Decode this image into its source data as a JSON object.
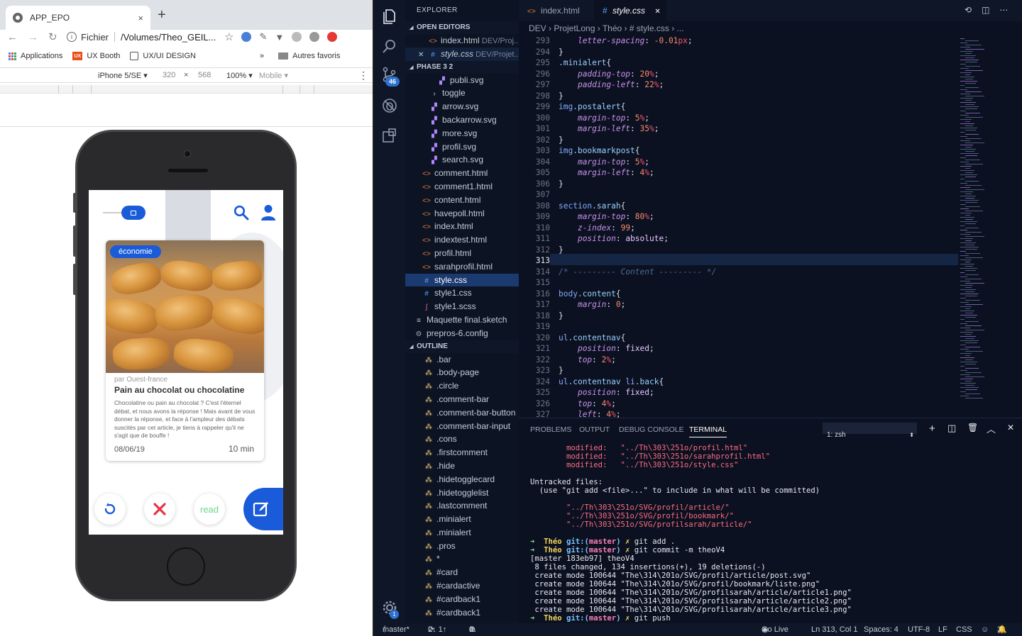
{
  "browser": {
    "tab_title": "APP_EPO",
    "close": "×",
    "new_tab": "+",
    "address_label": "Fichier",
    "address_path": "/Volumes/Theo_GEIL...",
    "bookmarks": [
      {
        "label": "Applications"
      },
      {
        "label": "UX Booth"
      },
      {
        "label": "UX/UI DESIGN"
      }
    ],
    "bookmarks_more": "»",
    "other_favorites": "Autres favoris",
    "device_toolbar": {
      "device": "iPhone 5/SE ▾",
      "width": "320",
      "times": "×",
      "height": "568",
      "zoom": "100% ▾",
      "network": "Mobile ▾",
      "more": "⋮"
    }
  },
  "app": {
    "card": {
      "badge": "économie",
      "source": "par Ouest-france",
      "title": "Pain au chocolat ou chocolatine",
      "body": "Chocolatine ou pain au chocolat ? C'est l'éternel débat, et nous avons la réponse ! Mais avant de vous donner la réponse, et face à l'ampleur des débats suscités par cet article, je tiens à rappeler qu'il ne s'agit que de bouffe !",
      "date": "08/06/19",
      "duration": "10 min"
    },
    "actions": {
      "read": "read"
    }
  },
  "vscode": {
    "explorer_title": "EXPLORER",
    "open_editors_title": "OPEN EDITORS",
    "open_editors": [
      {
        "close": "",
        "icon": "html",
        "name": "index.html",
        "path": "DEV/Proj..."
      },
      {
        "close": "✕",
        "icon": "css",
        "name": "style.css",
        "path": "DEV/Projet..."
      }
    ],
    "folder_title": "PHASE 3 2",
    "files": [
      {
        "icon": "svg",
        "name": "publi.svg",
        "indent": 3
      },
      {
        "icon": "folder",
        "name": "toggle",
        "indent": 2
      },
      {
        "icon": "svg",
        "name": "arrow.svg",
        "indent": 2
      },
      {
        "icon": "svg",
        "name": "backarrow.svg",
        "indent": 2
      },
      {
        "icon": "svg",
        "name": "more.svg",
        "indent": 2
      },
      {
        "icon": "svg",
        "name": "profil.svg",
        "indent": 2
      },
      {
        "icon": "svg",
        "name": "search.svg",
        "indent": 2
      },
      {
        "icon": "html",
        "name": "comment.html",
        "indent": 1
      },
      {
        "icon": "html",
        "name": "comment1.html",
        "indent": 1
      },
      {
        "icon": "html",
        "name": "content.html",
        "indent": 1
      },
      {
        "icon": "html",
        "name": "havepoll.html",
        "indent": 1
      },
      {
        "icon": "html",
        "name": "index.html",
        "indent": 1
      },
      {
        "icon": "html",
        "name": "indextest.html",
        "indent": 1
      },
      {
        "icon": "html",
        "name": "profil.html",
        "indent": 1
      },
      {
        "icon": "html",
        "name": "sarahprofil.html",
        "indent": 1
      },
      {
        "icon": "css",
        "name": "style.css",
        "indent": 1,
        "selected": true
      },
      {
        "icon": "css",
        "name": "style1.css",
        "indent": 1
      },
      {
        "icon": "scss",
        "name": "style1.scss",
        "indent": 1
      },
      {
        "icon": "sketch",
        "name": "Maquette final.sketch",
        "indent": 0
      },
      {
        "icon": "config",
        "name": "prepros-6.config",
        "indent": 0
      }
    ],
    "outline_title": "OUTLINE",
    "outline": [
      ".bar",
      ".body-page",
      ".circle",
      ".comment-bar",
      ".comment-bar-button",
      ".comment-bar-input",
      ".cons",
      ".firstcomment",
      ".hide",
      ".hidetogglecard",
      ".hidetogglelist",
      ".lastcomment",
      ".minialert",
      ".minialert",
      ".pros",
      "*",
      "#card",
      "#cardactive",
      "#cardback1",
      "#cardback1"
    ],
    "scm_badge": "46",
    "settings_badge": "1",
    "editor_tabs": [
      {
        "label": "index.html"
      },
      {
        "label": "style.css",
        "close": "✕"
      }
    ],
    "breadcrumbs": "DEV › ProjetLong › Théo › # style.css › ...",
    "line_numbers": [
      "293",
      "294",
      "295",
      "296",
      "297",
      "298",
      "299",
      "300",
      "301",
      "302",
      "303",
      "304",
      "305",
      "306",
      "307",
      "308",
      "309",
      "310",
      "311",
      "312",
      "313",
      "314",
      "315",
      "316",
      "317",
      "318",
      "319",
      "320",
      "321",
      "322",
      "323",
      "324",
      "325",
      "326",
      "327"
    ],
    "code_lines": [
      [
        [
          "    ",
          ""
        ],
        [
          "letter-spacing",
          "p"
        ],
        [
          ": ",
          ""
        ],
        [
          "-0.01",
          "n"
        ],
        [
          "px",
          "u"
        ],
        [
          ";",
          ""
        ]
      ],
      [
        [
          "}",
          ""
        ]
      ],
      [
        [
          ".minialert",
          "s"
        ],
        [
          "{",
          ""
        ]
      ],
      [
        [
          "    ",
          ""
        ],
        [
          "padding-top",
          "p"
        ],
        [
          ": ",
          ""
        ],
        [
          "20",
          "n"
        ],
        [
          "%",
          "u"
        ],
        [
          ";",
          ""
        ]
      ],
      [
        [
          "    ",
          ""
        ],
        [
          "padding-left",
          "p"
        ],
        [
          ": ",
          ""
        ],
        [
          "22",
          "n"
        ],
        [
          "%",
          "u"
        ],
        [
          ";",
          ""
        ]
      ],
      [
        [
          "}",
          ""
        ]
      ],
      [
        [
          "img",
          "t"
        ],
        [
          ".postalert",
          "s"
        ],
        [
          "{",
          ""
        ]
      ],
      [
        [
          "    ",
          ""
        ],
        [
          "margin-top",
          "p"
        ],
        [
          ": ",
          ""
        ],
        [
          "5",
          "n"
        ],
        [
          "%",
          "u"
        ],
        [
          ";",
          ""
        ]
      ],
      [
        [
          "    ",
          ""
        ],
        [
          "margin-left",
          "p"
        ],
        [
          ": ",
          ""
        ],
        [
          "35",
          "n"
        ],
        [
          "%",
          "u"
        ],
        [
          ";",
          ""
        ]
      ],
      [
        [
          "}",
          ""
        ]
      ],
      [
        [
          "img",
          "t"
        ],
        [
          ".bookmarkpost",
          "s"
        ],
        [
          "{",
          ""
        ]
      ],
      [
        [
          "    ",
          ""
        ],
        [
          "margin-top",
          "p"
        ],
        [
          ": ",
          ""
        ],
        [
          "5",
          "n"
        ],
        [
          "%",
          "u"
        ],
        [
          ";",
          ""
        ]
      ],
      [
        [
          "    ",
          ""
        ],
        [
          "margin-left",
          "p"
        ],
        [
          ": ",
          ""
        ],
        [
          "4",
          "n"
        ],
        [
          "%",
          "u"
        ],
        [
          ";",
          ""
        ]
      ],
      [
        [
          "}",
          ""
        ]
      ],
      [
        [
          "",
          ""
        ]
      ],
      [
        [
          "section",
          "t"
        ],
        [
          ".sarah",
          "s"
        ],
        [
          "{",
          ""
        ]
      ],
      [
        [
          "    ",
          ""
        ],
        [
          "margin-top",
          "p"
        ],
        [
          ": ",
          ""
        ],
        [
          "80",
          "n"
        ],
        [
          "%",
          "u"
        ],
        [
          ";",
          ""
        ]
      ],
      [
        [
          "    ",
          ""
        ],
        [
          "z-index",
          "p"
        ],
        [
          ": ",
          ""
        ],
        [
          "99",
          "n"
        ],
        [
          ";",
          ""
        ]
      ],
      [
        [
          "    ",
          ""
        ],
        [
          "position",
          "p"
        ],
        [
          ": ",
          ""
        ],
        [
          "absolute",
          "k"
        ],
        [
          ";",
          ""
        ]
      ],
      [
        [
          "}",
          ""
        ]
      ],
      [
        [
          "",
          ""
        ]
      ],
      [
        [
          "/* --------- Content --------- */",
          "c"
        ]
      ],
      [
        [
          "",
          ""
        ]
      ],
      [
        [
          "body",
          "t"
        ],
        [
          ".content",
          "s"
        ],
        [
          "{",
          ""
        ]
      ],
      [
        [
          "    ",
          ""
        ],
        [
          "margin",
          "p"
        ],
        [
          ": ",
          ""
        ],
        [
          "0",
          "n"
        ],
        [
          ";",
          ""
        ]
      ],
      [
        [
          "}",
          ""
        ]
      ],
      [
        [
          "",
          ""
        ]
      ],
      [
        [
          "ul",
          "t"
        ],
        [
          ".contentnav",
          "s"
        ],
        [
          "{",
          ""
        ]
      ],
      [
        [
          "    ",
          ""
        ],
        [
          "position",
          "p"
        ],
        [
          ": ",
          ""
        ],
        [
          "fixed",
          "k"
        ],
        [
          ";",
          ""
        ]
      ],
      [
        [
          "    ",
          ""
        ],
        [
          "top",
          "p"
        ],
        [
          ": ",
          ""
        ],
        [
          "2",
          "n"
        ],
        [
          "%",
          "u"
        ],
        [
          ";",
          ""
        ]
      ],
      [
        [
          "}",
          ""
        ]
      ],
      [
        [
          "ul",
          "t"
        ],
        [
          ".contentnav ",
          "s"
        ],
        [
          "li",
          "t"
        ],
        [
          ".back",
          "s"
        ],
        [
          "{",
          ""
        ]
      ],
      [
        [
          "    ",
          ""
        ],
        [
          "position",
          "p"
        ],
        [
          ": ",
          ""
        ],
        [
          "fixed",
          "k"
        ],
        [
          ";",
          ""
        ]
      ],
      [
        [
          "    ",
          ""
        ],
        [
          "top",
          "p"
        ],
        [
          ": ",
          ""
        ],
        [
          "4",
          "n"
        ],
        [
          "%",
          "u"
        ],
        [
          ";",
          ""
        ]
      ],
      [
        [
          "    ",
          ""
        ],
        [
          "left",
          "p"
        ],
        [
          ": ",
          ""
        ],
        [
          "4",
          "n"
        ],
        [
          "%",
          "u"
        ],
        [
          ";",
          ""
        ]
      ]
    ],
    "panel_tabs": [
      "PROBLEMS",
      "OUTPUT",
      "DEBUG CONSOLE",
      "TERMINAL"
    ],
    "terminal_select": "1: zsh",
    "terminal_lines": [
      [
        [
          "        modified:   \"../Th\\303\\251o/profil.html\"",
          "r"
        ]
      ],
      [
        [
          "        modified:   \"../Th\\303\\251o/sarahprofil.html\"",
          "r"
        ]
      ],
      [
        [
          "        modified:   \"../Th\\303\\251o/style.css\"",
          "r"
        ]
      ],
      [
        [
          "",
          ""
        ]
      ],
      [
        [
          "Untracked files:",
          ""
        ]
      ],
      [
        [
          "  (use \"git add <file>...\" to include in what will be committed)",
          ""
        ]
      ],
      [
        [
          "",
          ""
        ]
      ],
      [
        [
          "        \"../Th\\303\\251o/SVG/profil/article/\"",
          "r"
        ]
      ],
      [
        [
          "        \"../Th\\303\\251o/SVG/profil/bookmark/\"",
          "r"
        ]
      ],
      [
        [
          "        \"../Th\\303\\251o/SVG/profilsarah/article/\"",
          "r"
        ]
      ],
      [
        [
          "",
          ""
        ]
      ],
      [
        [
          "➜  ",
          "g"
        ],
        [
          "Théo ",
          "y"
        ],
        [
          "git:(",
          "c"
        ],
        [
          "master",
          "m"
        ],
        [
          ")",
          "c"
        ],
        [
          " ✗ ",
          "y"
        ],
        [
          "git add .",
          ""
        ]
      ],
      [
        [
          "➜  ",
          "g"
        ],
        [
          "Théo ",
          "y"
        ],
        [
          "git:(",
          "c"
        ],
        [
          "master",
          "m"
        ],
        [
          ")",
          "c"
        ],
        [
          " ✗ ",
          "y"
        ],
        [
          "git commit -m theoV4",
          ""
        ]
      ],
      [
        [
          "[master 183eb97] theoV4",
          ""
        ]
      ],
      [
        [
          " 8 files changed, 134 insertions(+), 19 deletions(-)",
          ""
        ]
      ],
      [
        [
          " create mode 100644 \"The\\314\\201o/SVG/profil/article/post.svg\"",
          ""
        ]
      ],
      [
        [
          " create mode 100644 \"The\\314\\201o/SVG/profil/bookmark/liste.png\"",
          ""
        ]
      ],
      [
        [
          " create mode 100644 \"The\\314\\201o/SVG/profilsarah/article/article1.png\"",
          ""
        ]
      ],
      [
        [
          " create mode 100644 \"The\\314\\201o/SVG/profilsarah/article/article2.png\"",
          ""
        ]
      ],
      [
        [
          " create mode 100644 \"The\\314\\201o/SVG/profilsarah/article/article3.png\"",
          ""
        ]
      ],
      [
        [
          "➜  ",
          "g"
        ],
        [
          "Théo ",
          "y"
        ],
        [
          "git:(",
          "c"
        ],
        [
          "master",
          "m"
        ],
        [
          ")",
          "c"
        ],
        [
          " ✗ ",
          "y"
        ],
        [
          "git push",
          ""
        ]
      ]
    ],
    "status": {
      "branch": "master*",
      "sync": "2↓ 1↑",
      "errors": "0",
      "warnings": "0",
      "golive": "Go Live",
      "position": "Ln 313, Col 1",
      "spaces": "Spaces: 4",
      "encoding": "UTF-8",
      "eol": "LF",
      "language": "CSS",
      "notifications": "3"
    },
    "colors": {
      "selection": "#1b3a70",
      "activity_bg": "#0e1628",
      "editor_bg": "#0b1120"
    }
  }
}
